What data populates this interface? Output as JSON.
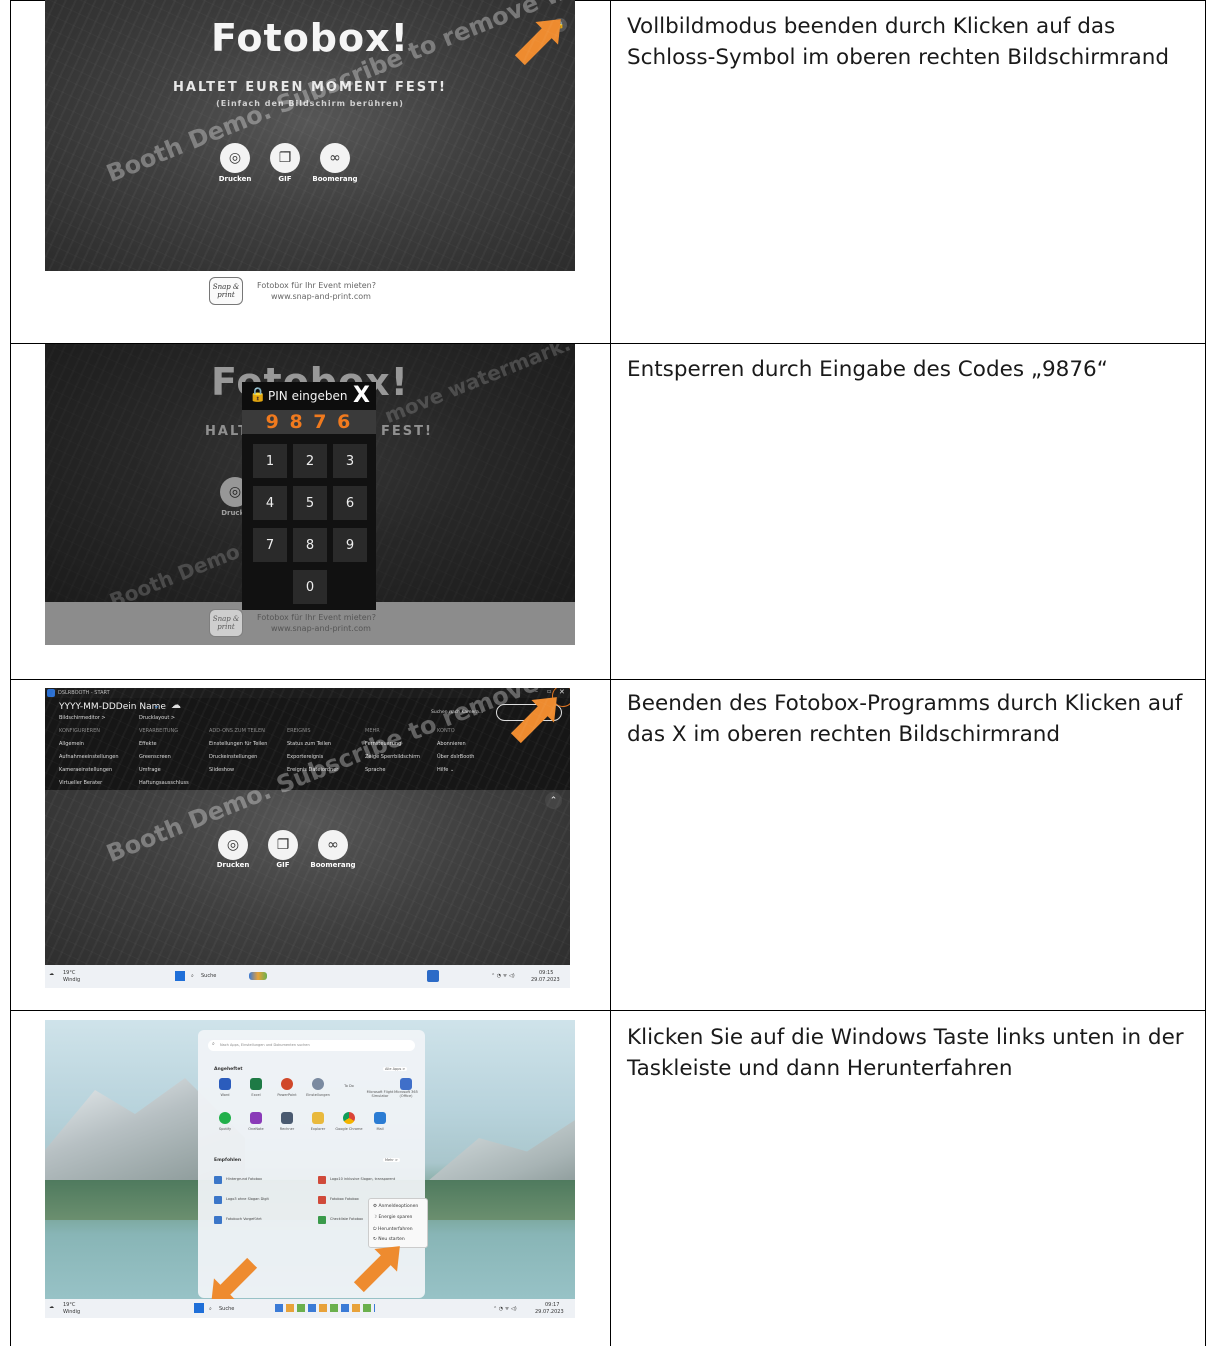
{
  "rows": [
    {
      "instruction": "Vollbildmodus beenden durch Klicken auf das Schloss-Symbol im oberen rechten Bildschirmrand"
    },
    {
      "instruction": "Entsperren durch Eingabe des Codes „9876“"
    },
    {
      "instruction": "Beenden des Fotobox-Programms durch Klicken auf das X im oberen rechten Bildschirmrand"
    },
    {
      "instruction": "Klicken Sie auf die Windows Taste links unten in der Taskleiste und dann Herunterfahren"
    }
  ],
  "photobooth": {
    "title": "Fotobox!",
    "subtitle": "HALTET EUREN MOMENT FEST!",
    "subtitle2": "(Einfach den Bildschirm berühren)",
    "buttons": [
      {
        "label": "Drucken",
        "icon": "camera-icon"
      },
      {
        "label": "GIF",
        "icon": "gallery-icon"
      },
      {
        "label": "Boomerang",
        "icon": "infinity-icon"
      }
    ],
    "watermark": "Booth Demo. Subscribe to remove watermark.",
    "footer_line1": "Fotobox für Ihr Event mieten?",
    "footer_line2": "www.snap-and-print.com",
    "logo_text": "Snap & print"
  },
  "pin_dialog": {
    "title": "PIN eingeben",
    "close": "X",
    "code": "9 8 7 6",
    "keys": [
      "1",
      "2",
      "3",
      "4",
      "5",
      "6",
      "7",
      "8",
      "9",
      "0"
    ],
    "bg_title_fragment": "Fotobox!",
    "bg_left": "HALT",
    "bg_right": "FEST!",
    "bg_btn": "Drucke",
    "bg_wm_right": "move watermark.",
    "bg_wm_left": "Booth Demo."
  },
  "app_window": {
    "window_title": "DSLRBOOTH - START",
    "event_name": "YYYY-MM-DDDein Name",
    "camera_search": "Suchen nach Kamera...",
    "columns": [
      {
        "items": [
          "Bildschirmeditor >",
          "KONFIGURIEREN",
          "Allgemein",
          "Aufnahmeeinstellungen",
          "Kameraeinstellungen",
          "Virtueller Berater"
        ]
      },
      {
        "items": [
          "Drucklayout >",
          "VERARBEITUNG",
          "Effekte",
          "Greenscreen",
          "Umfrage",
          "Haftungsausschluss"
        ]
      },
      {
        "items": [
          "ADD-ONS ZUM TEILEN",
          "Einstellungen für Teilen",
          "Druckeinstellungen",
          "Slideshow"
        ]
      },
      {
        "items": [
          "EREIGNIS",
          "Status zum Teilen",
          "Exportereignis",
          "Ereignis Dateiordner"
        ]
      },
      {
        "items": [
          "MEHR",
          "Fernsteuerung",
          "Zeige Sperrbildschirm",
          "Sprache"
        ]
      },
      {
        "items": [
          "KONTO",
          "Abonnieren",
          "Über dslrBooth",
          "Hilfe ⌄"
        ]
      }
    ],
    "taskbar": {
      "weather_temp": "19°C",
      "weather_desc": "Windig",
      "search": "Suche",
      "time": "09:15",
      "date": "29.07.2023"
    }
  },
  "windows_start": {
    "search_placeholder": "Nach Apps, Einstellungen und Dokumenten suchen",
    "pinned_header": "Angeheftet",
    "all_apps": "Alle Apps >",
    "pinned_apps": [
      "Word",
      "Excel",
      "PowerPoint",
      "Einstellungen",
      "To Do",
      "Microsoft Flight Simulator",
      "Microsoft 365 (Office)",
      "Spotify",
      "OneNote",
      "Rechner",
      "Explorer",
      "Google Chrome",
      "Mail"
    ],
    "recommended_header": "Empfohlen",
    "more": "Mehr >",
    "recommended": [
      "Hintergrund Fotobox",
      "Logo3 ohne Slogan Digit",
      "Fotobuch Vorgeführt",
      "Logo10 inklusive Slogan, transparent",
      "Fotobox Fotobox",
      "Checkliste Fotobox"
    ],
    "power_menu": [
      "Anmeldeoptionen",
      "Energie sparen",
      "Herunterfahren",
      "Neu starten"
    ],
    "taskbar": {
      "weather_temp": "19°C",
      "weather_desc": "Windig",
      "search": "Suche",
      "time": "09:17",
      "date": "29.07.2023"
    }
  }
}
